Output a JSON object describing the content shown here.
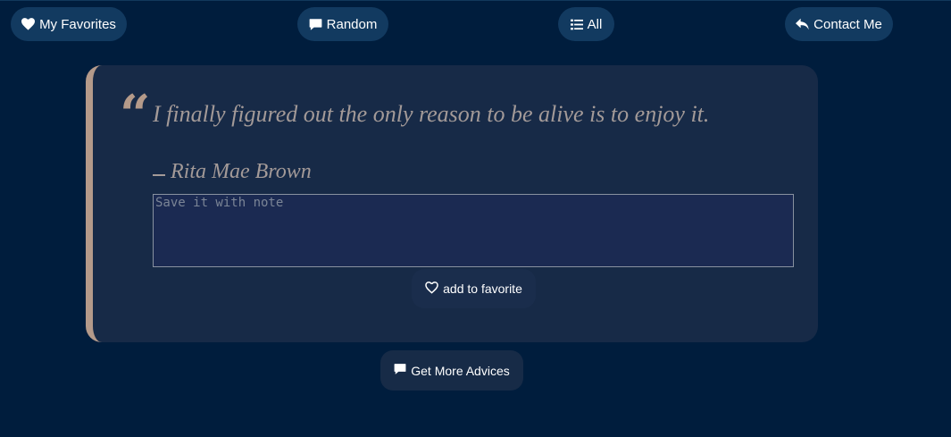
{
  "nav": {
    "favorites": {
      "label": "My Favorites",
      "icon": "heart-icon"
    },
    "random": {
      "label": "Random",
      "icon": "comment-icon"
    },
    "all": {
      "label": "All",
      "icon": "list-icon"
    },
    "contact": {
      "label": "Contact Me",
      "icon": "reply-icon"
    }
  },
  "quote": {
    "text": "I finally figured out the only reason to be alive is to enjoy it.",
    "author": "Rita Mae Brown",
    "mark": "“"
  },
  "note": {
    "placeholder": "Save it with note",
    "value": ""
  },
  "actions": {
    "add_favorite": {
      "label": "add to favorite",
      "icon": "heart-outline-icon"
    },
    "more": {
      "label": "Get More Advices",
      "icon": "comment-icon"
    }
  },
  "colors": {
    "background": "#001d3d",
    "button": "#123a60",
    "card": "#172a47",
    "accent": "#b49a8a",
    "quote_text": "#a39a98"
  }
}
